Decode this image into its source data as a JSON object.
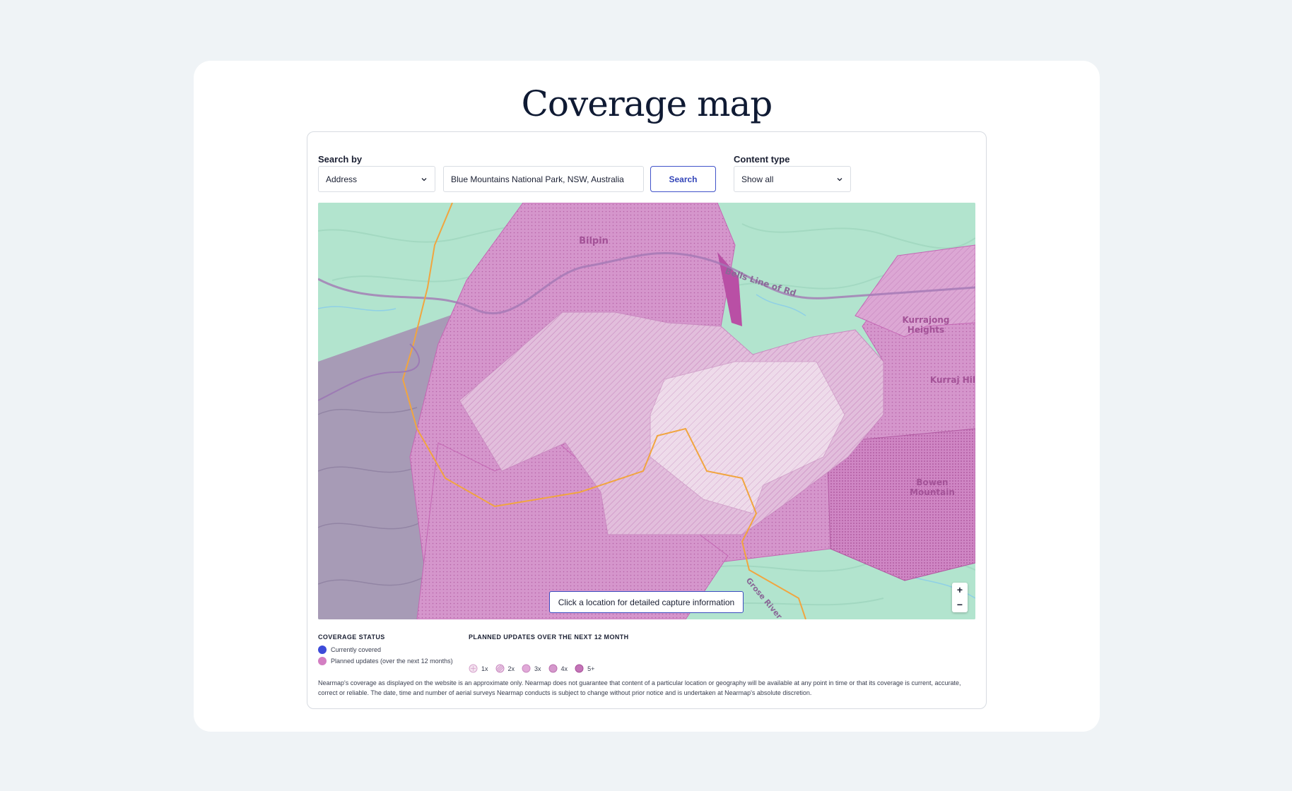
{
  "page": {
    "title": "Coverage map"
  },
  "search": {
    "search_by_label": "Search by",
    "search_by_value": "Address",
    "address_value": "Blue Mountains National Park, NSW, Australia",
    "search_button": "Search",
    "content_type_label": "Content type",
    "content_type_value": "Show all"
  },
  "map": {
    "places": {
      "bilpin": "Bilpin",
      "bells_line": "Bells Line of Rd",
      "kurrajong_1": "Kurrajong",
      "kurrajong_2": "Heights",
      "kurrajong_hills": "Kurraj Hil",
      "bowen_1": "Bowen",
      "bowen_2": "Mountain",
      "river": "Grose River"
    },
    "tooltip": "Click a location for detailed capture information",
    "zoom_in": "+",
    "zoom_out": "−"
  },
  "legend": {
    "coverage_status_title": "COVERAGE STATUS",
    "currently_covered": "Currently covered",
    "planned_updates": "Planned updates (over the next 12 months)",
    "planned_title": "PLANNED UPDATES OVER THE NEXT 12 MONTH",
    "frequency": [
      "1x",
      "2x",
      "3x",
      "4x",
      "5+"
    ],
    "colors": {
      "covered": "#3d4bd9",
      "planned": "#d37ec2"
    }
  },
  "disclaimer": "Nearmap's coverage as displayed on the website is an approximate only. Nearmap does not guarantee that content of a particular location or geography will be available at any point in time or that its coverage is current, accurate, correct or reliable. The date, time and number of aerial surveys Nearmap conducts is subject to change without prior notice and is undertaken at Nearmap's absolute discretion."
}
